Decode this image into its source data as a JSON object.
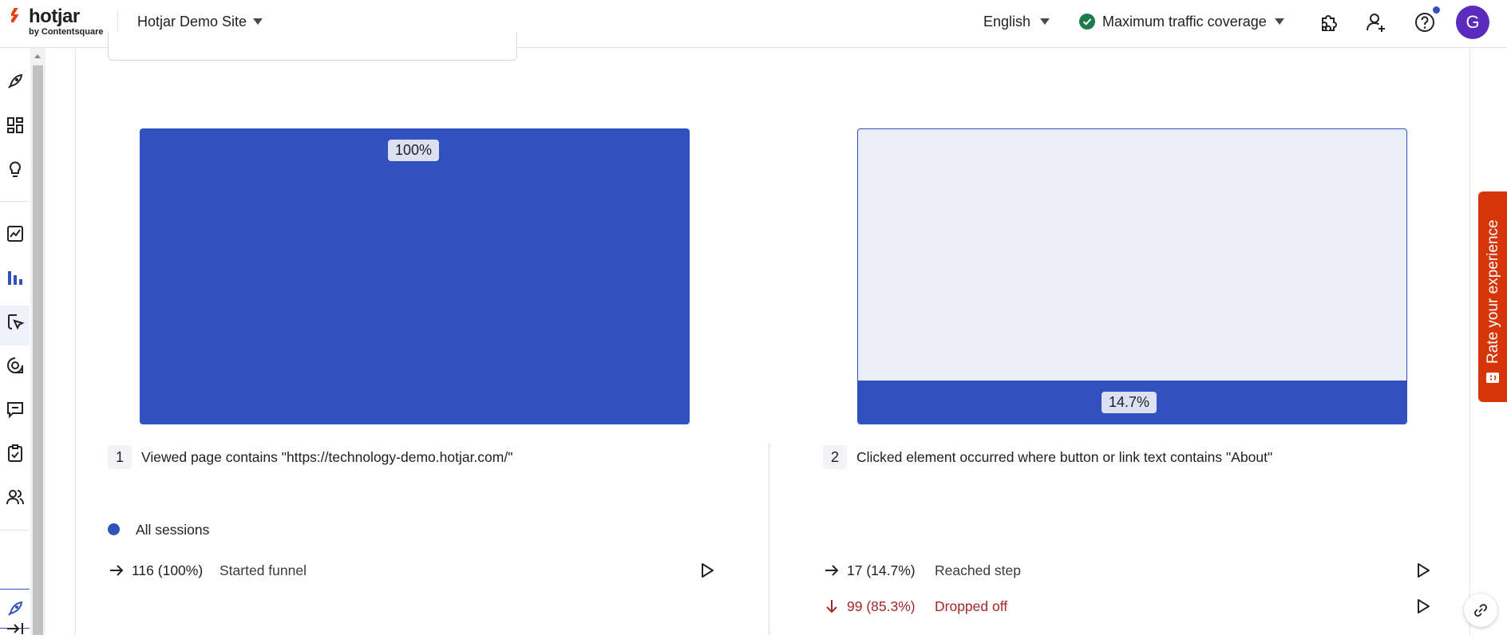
{
  "header": {
    "logo_text": "hotjar",
    "logo_sub": "by Contentsquare",
    "site_name": "Hotjar Demo Site",
    "language": "English",
    "coverage": "Maximum traffic coverage",
    "avatar_initial": "G",
    "icons": [
      "integrations-icon",
      "add-user-icon",
      "help-icon"
    ]
  },
  "sidebar": {
    "icons": [
      "rocket-icon",
      "dashboard-icon",
      "lightbulb-icon",
      "trends-icon",
      "funnels-icon",
      "heatmaps-icon",
      "recordings-icon",
      "feedback-icon",
      "surveys-icon",
      "interviews-icon",
      "rocket-icon",
      "collapse-icon"
    ],
    "active": "funnels-icon"
  },
  "funnel": {
    "color": "#3152be",
    "steps": [
      {
        "number": "1",
        "label": "Viewed page contains \"https://technology-demo.hotjar.com/\"",
        "percent_label": "100%",
        "fill": 1.0
      },
      {
        "number": "2",
        "label": "Clicked element occurred where button or link text contains \"About\"",
        "percent_label": "14.7%",
        "fill": 0.147
      }
    ],
    "legend": "All sessions",
    "stats": {
      "step1": {
        "value": "116 (100%)",
        "label": "Started funnel"
      },
      "step2_reached": {
        "value": "17 (14.7%)",
        "label": "Reached step"
      },
      "step2_dropped": {
        "value": "99 (85.3%)",
        "label": "Dropped off"
      }
    }
  },
  "feedback_tab": {
    "label": "Rate your experience",
    "color": "#d6350a"
  }
}
